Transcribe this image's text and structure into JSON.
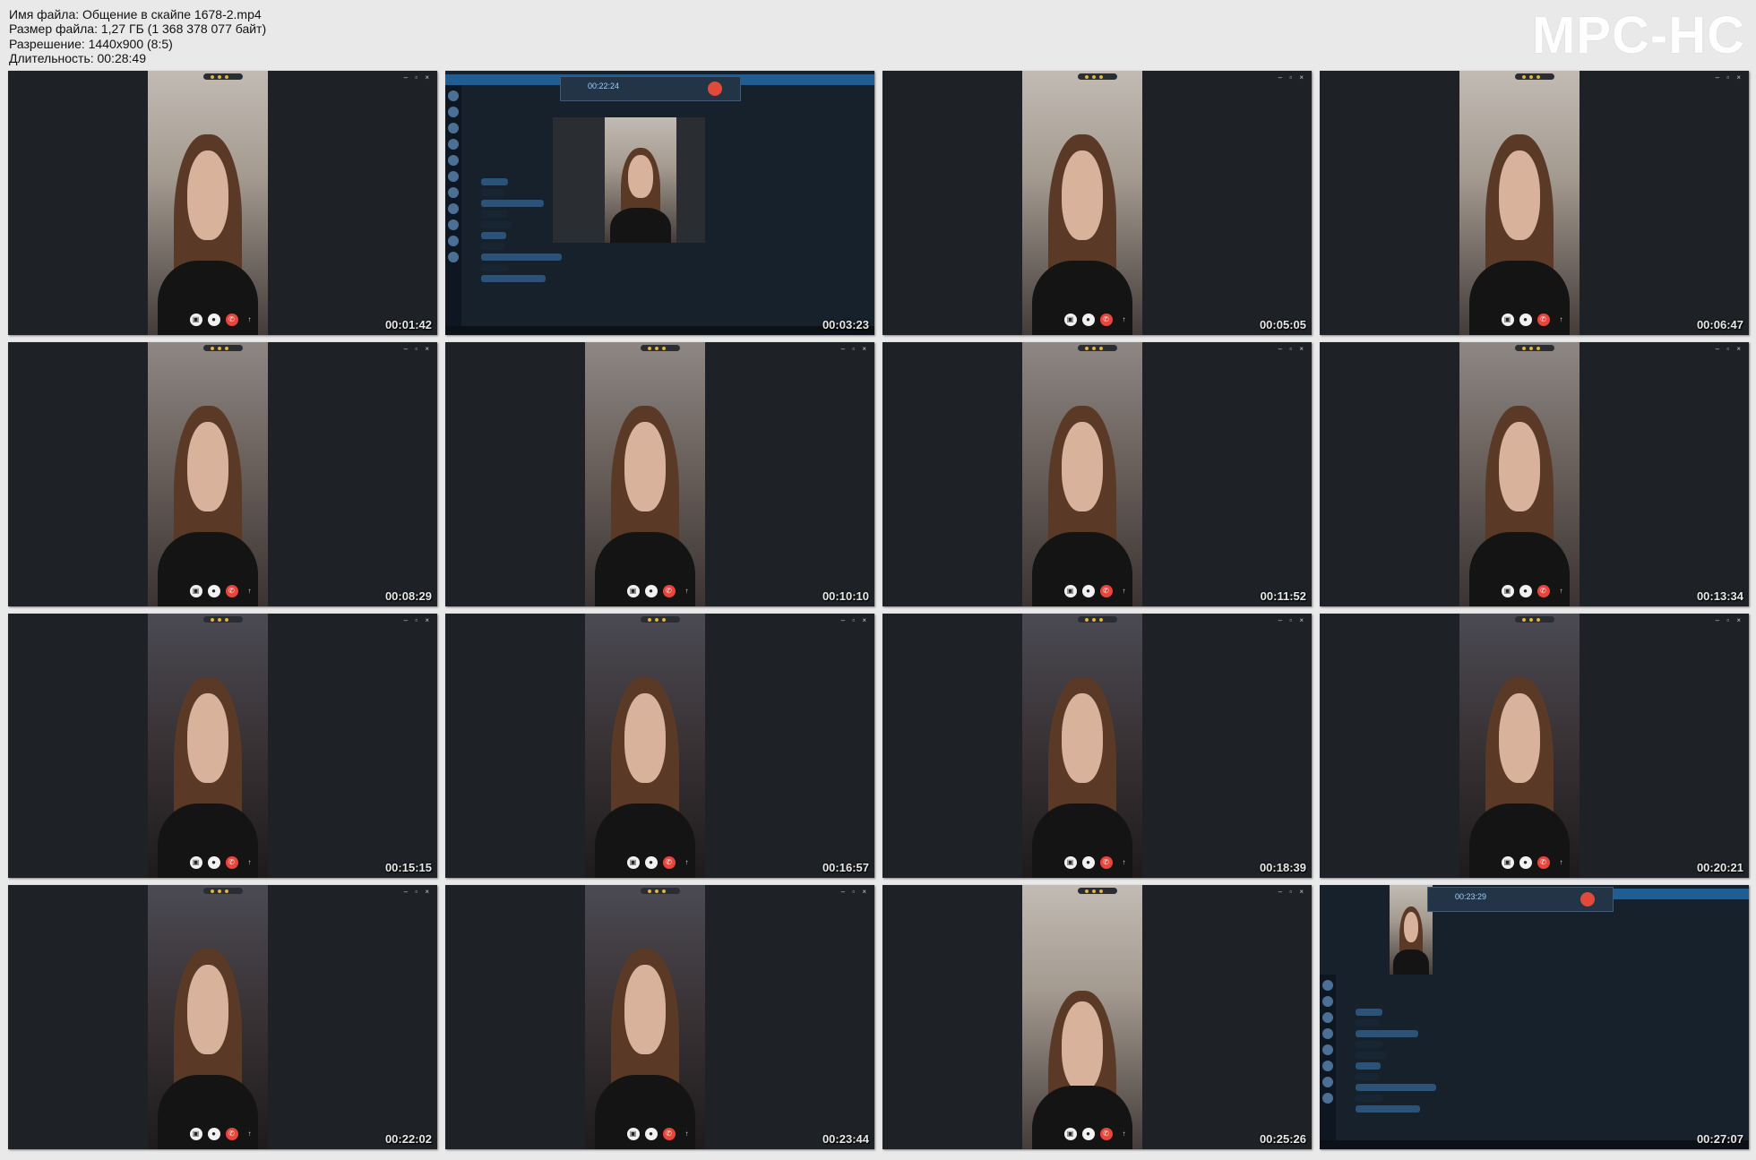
{
  "header": {
    "file_name": "Имя файла: Общение в скайпе 1678-2.mp4",
    "file_size": "Размер файла: 1,27 ГБ (1 368 378 077 байт)",
    "resolution": "Разрешение: 1440x900 (8:5)",
    "duration": "Длительность: 00:28:49"
  },
  "brand": "MPC-HC",
  "thumbnails": [
    {
      "time": "00:01:42"
    },
    {
      "time": "00:03:23"
    },
    {
      "time": "00:05:05"
    },
    {
      "time": "00:06:47"
    },
    {
      "time": "00:08:29"
    },
    {
      "time": "00:10:10"
    },
    {
      "time": "00:11:52"
    },
    {
      "time": "00:13:34"
    },
    {
      "time": "00:15:15"
    },
    {
      "time": "00:16:57"
    },
    {
      "time": "00:18:39"
    },
    {
      "time": "00:20:21"
    },
    {
      "time": "00:22:02"
    },
    {
      "time": "00:23:44"
    },
    {
      "time": "00:25:26"
    },
    {
      "time": "00:27:07"
    }
  ],
  "recorder": {
    "thumb2_time": "00:22:24",
    "thumb16_time": "00:23:29"
  }
}
